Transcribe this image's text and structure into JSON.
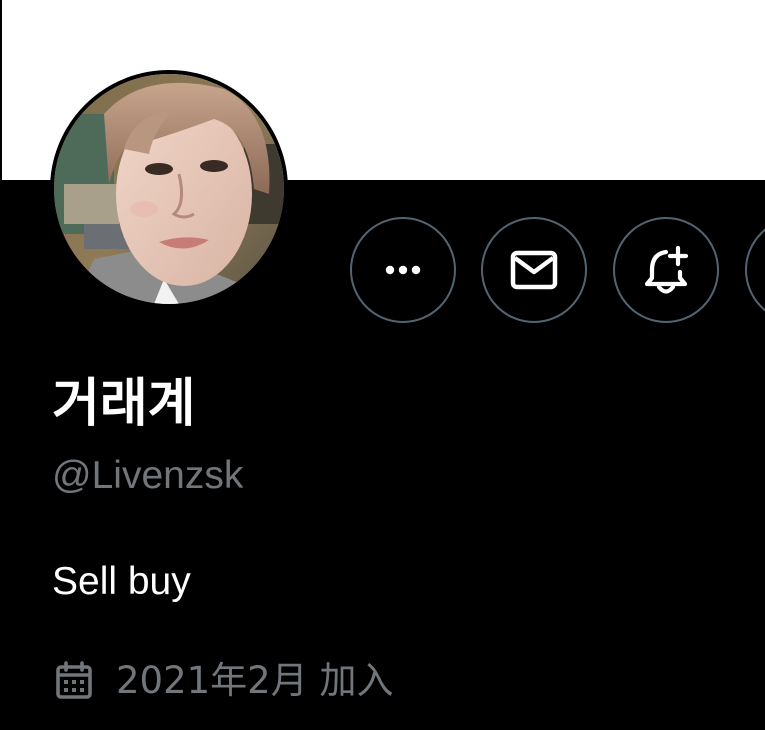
{
  "profile": {
    "display_name": "거래계",
    "handle": "@Livenzsk",
    "bio": "Sell buy",
    "joined": "2021年2月 加入",
    "avatar_alt": "profile photo"
  },
  "actions": {
    "more_icon": "more-dots-icon",
    "message_icon": "envelope-icon",
    "notify_icon": "bell-plus-icon",
    "follow_icon": "partial-button"
  },
  "colors": {
    "background": "#000000",
    "banner": "#ffffff",
    "primary_text": "#ffffff",
    "secondary_text": "#71767b",
    "button_border": "#536471"
  }
}
